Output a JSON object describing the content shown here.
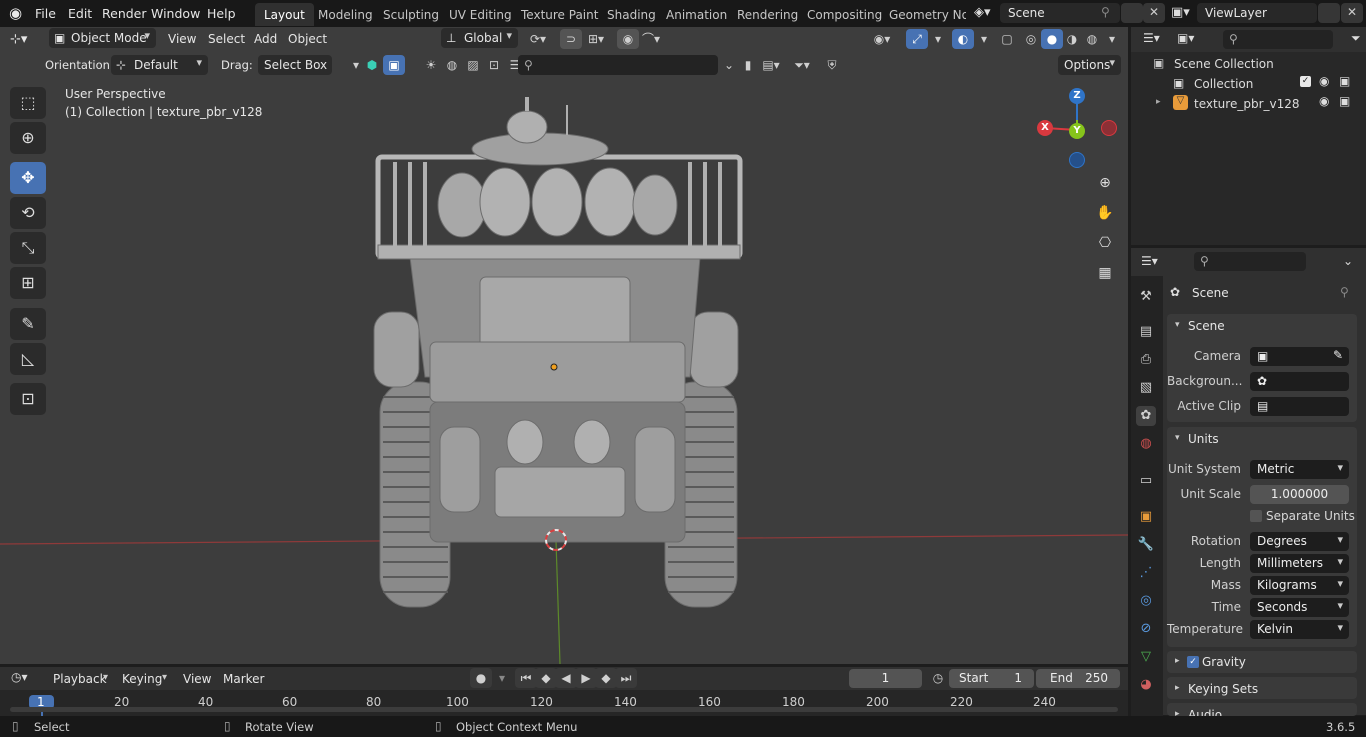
{
  "menu": [
    "File",
    "Edit",
    "Render",
    "Window",
    "Help"
  ],
  "workspaces": [
    "Layout",
    "Modeling",
    "Sculpting",
    "UV Editing",
    "Texture Paint",
    "Shading",
    "Animation",
    "Rendering",
    "Compositing",
    "Geometry Noc"
  ],
  "scene_name": "Scene",
  "view_layer": "ViewLayer",
  "viewport": {
    "mode": "Object Mode",
    "menus": [
      "View",
      "Select",
      "Add",
      "Object"
    ],
    "transform_orientation": "Global",
    "orientation_label": "Orientation:",
    "orientation_value": "Default",
    "drag_label": "Drag:",
    "drag_value": "Select Box",
    "options_label": "Options",
    "info_line1": "User Perspective",
    "info_line2": "(1) Collection | texture_pbr_v128",
    "gizmo": {
      "z": "Z",
      "y": "Y",
      "x": "X"
    }
  },
  "outliner": {
    "root": "Scene Collection",
    "items": [
      {
        "label": "Collection"
      },
      {
        "label": "texture_pbr_v128"
      }
    ]
  },
  "properties": {
    "context": "Scene",
    "scene_panel": {
      "title": "Scene",
      "camera_label": "Camera",
      "background_label": "Backgroun...",
      "active_clip_label": "Active Clip"
    },
    "units_panel": {
      "title": "Units",
      "unit_system_label": "Unit System",
      "unit_system": "Metric",
      "unit_scale_label": "Unit Scale",
      "unit_scale": "1.000000",
      "separate_units": "Separate Units",
      "rotation_label": "Rotation",
      "rotation": "Degrees",
      "length_label": "Length",
      "length": "Millimeters",
      "mass_label": "Mass",
      "mass": "Kilograms",
      "time_label": "Time",
      "time": "Seconds",
      "temperature_label": "Temperature",
      "temperature": "Kelvin"
    },
    "gravity": "Gravity",
    "keying_sets": "Keying Sets",
    "audio": "Audio"
  },
  "timeline": {
    "menus": [
      "Playback",
      "Keying",
      "View",
      "Marker"
    ],
    "current_frame": "1",
    "start_label": "Start",
    "start": "1",
    "end_label": "End",
    "end": "250",
    "ticks": [
      "1",
      "20",
      "40",
      "60",
      "80",
      "100",
      "120",
      "140",
      "160",
      "180",
      "200",
      "220",
      "240"
    ]
  },
  "status": {
    "select": "Select",
    "rotate": "Rotate View",
    "context_menu": "Object Context Menu",
    "version": "3.6.5"
  },
  "colors": {
    "accent": "#4772b3",
    "x_axis": "#d9393f",
    "y_axis": "#86c41b",
    "z_axis": "#2f74c8"
  }
}
